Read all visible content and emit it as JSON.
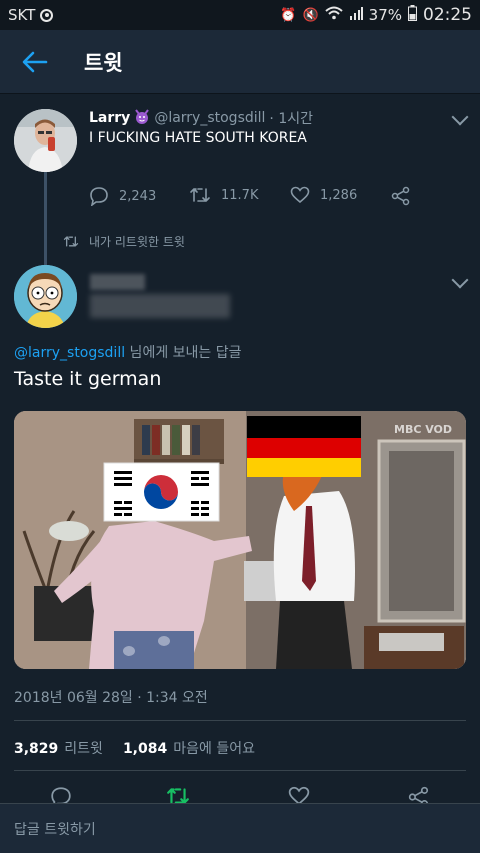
{
  "status_bar": {
    "carrier": "SKT",
    "battery": "37%",
    "time": "02:25"
  },
  "header": {
    "title": "트윗"
  },
  "original_tweet": {
    "name": "Larry",
    "handle": "@larry_stogsdill",
    "time": "· 1시간",
    "text": "I FUCKING HATE SOUTH KOREA",
    "replies": "2,243",
    "retweets": "11.7K",
    "likes": "1,286"
  },
  "retweet_note": "내가 리트윗한 트윗",
  "reply": {
    "name": "_",
    "mention": "@larry_stogsdill",
    "replying_suffix": " 님에게 보내는 답글",
    "text": "Taste it german",
    "media_watermark": "MBC VOD",
    "timestamp": "2018년 06월 28일 · 1:34 오전",
    "retweet_count": "3,829",
    "retweet_label": "리트윗",
    "like_count": "1,084",
    "like_label": "마음에 들어요"
  },
  "bottom_bar": {
    "placeholder": "답글 트윗하기"
  },
  "colors": {
    "accent": "#1da1f2",
    "background": "#15202b",
    "retweet_green": "#17bf63"
  }
}
